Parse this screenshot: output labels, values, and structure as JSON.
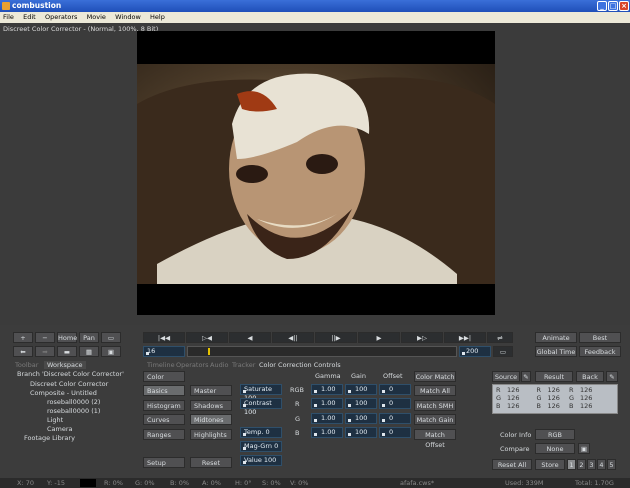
{
  "window": {
    "title": "combustion",
    "min": "_",
    "max": "□",
    "close": "×"
  },
  "menu": [
    "File",
    "Edit",
    "Operators",
    "Movie",
    "Window",
    "Help"
  ],
  "viewer": {
    "title": "Discreet Color Corrector -  (Normal, 100%, 8 Bit)"
  },
  "nav": {
    "home": "Home",
    "pan": "Pan"
  },
  "playback": {
    "frame": "16",
    "end_frame": "200",
    "icons": [
      "|◀◀",
      "▷◀",
      "◀",
      "◀||",
      "||▶",
      "▶",
      "▶▷",
      "▶▶|",
      "⇌"
    ]
  },
  "right_top": {
    "animate": "Animate",
    "best": "Best",
    "global_time": "Global Time",
    "feedback": "Feedback"
  },
  "panel_tabs": {
    "left": [
      "Toolbar",
      "Workspace"
    ],
    "main": [
      "Timeline",
      "Operators",
      "Audio",
      "Tracker",
      "Color Correction Controls"
    ]
  },
  "tree": {
    "branch": "Branch 'Discreet Color Corrector'",
    "op": "Discreet Color Corrector",
    "composite": "Composite - Untitled",
    "layer1": "roseball0000 (2)",
    "layer2": "roseball0000 (1)",
    "light": "Light",
    "camera": "Camera",
    "footage": "Footage Library"
  },
  "cc": {
    "color": "Color",
    "left_menu": [
      "Basics",
      "Histogram",
      "Curves",
      "Ranges"
    ],
    "setup": "Setup",
    "ranges": [
      "Master",
      "Shadows",
      "Midtones",
      "Highlights"
    ],
    "reset": "Reset",
    "saturate": "Saturate 100",
    "contrast": "Contrast 100",
    "temp": "Temp. 0",
    "maggrn": "Mag-Grn 0",
    "value": "Value 100",
    "col_headers": [
      "Gamma",
      "Gain",
      "Offset"
    ],
    "rows": [
      {
        "label": "RGB",
        "gamma": "1.00",
        "gain": "100",
        "offset": "0"
      },
      {
        "label": "R",
        "gamma": "1.00",
        "gain": "100",
        "offset": "0"
      },
      {
        "label": "G",
        "gamma": "1.00",
        "gain": "100",
        "offset": "0"
      },
      {
        "label": "B",
        "gamma": "1.00",
        "gain": "100",
        "offset": "0"
      }
    ],
    "match": [
      "Color Match",
      "Match All",
      "Match SMH",
      "Match Gain",
      "Match Offset"
    ]
  },
  "source": {
    "source_label": "Source",
    "result_label": "Result",
    "back_label": "Back",
    "channels": [
      "R",
      "G",
      "B"
    ],
    "value": "126",
    "color_info": "Color Info",
    "color_info_value": "RGB",
    "compare": "Compare",
    "compare_value": "None",
    "reset_all": "Reset All",
    "store": "Store",
    "slots": [
      "1",
      "2",
      "3",
      "4",
      "5"
    ]
  },
  "status": {
    "x": "X:  70",
    "y": "Y:  -15",
    "r": "R: 0%",
    "g": "G: 0%",
    "b": "B: 0%",
    "a": "A: 0%",
    "h": "H: 0°",
    "s": "S: 0%",
    "v": "V: 0%",
    "file": "afafa.cws*",
    "used": "Used: 339M",
    "total": "Total: 1.70G"
  },
  "colors": {
    "titlebar": "#2458c8",
    "panel": "#3c3c3c",
    "field": "#1e3042",
    "accent_field_text": "#e6eef5"
  }
}
